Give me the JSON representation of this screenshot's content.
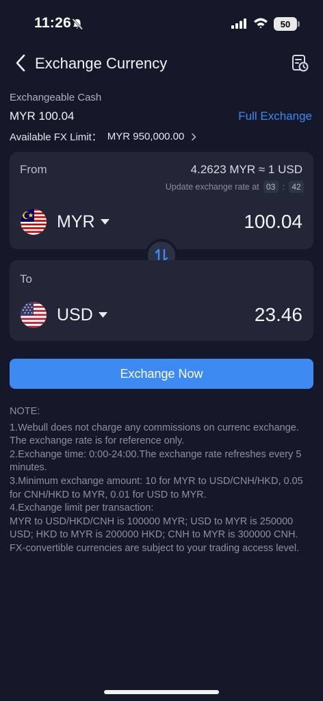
{
  "status_bar": {
    "time": "11:26",
    "battery": "50",
    "icons": [
      "bell-off-icon",
      "signal-icon",
      "wifi-icon",
      "battery-icon"
    ]
  },
  "nav": {
    "title": "Exchange Currency",
    "back_icon": "chevron-left-icon",
    "history_icon": "history-icon"
  },
  "cash": {
    "label": "Exchangeable Cash",
    "value": "MYR 100.04",
    "full_exchange": "Full Exchange",
    "fx_limit_label": "Available FX Limit：",
    "fx_limit_value": "MYR 950,000.00"
  },
  "from": {
    "label": "From",
    "rate": "4.2623 MYR ≈ 1 USD",
    "update_label": "Update exchange rate at",
    "update_min": "03",
    "update_sec": "42",
    "currency": "MYR",
    "amount": "100.04"
  },
  "to": {
    "label": "To",
    "currency": "USD",
    "amount": "23.46"
  },
  "exchange_button": "Exchange Now",
  "note": {
    "title": "NOTE:",
    "lines": [
      "1.Webull does not charge any commissions on currenc exchange. The exchange rate is for reference only.",
      "2.Exchange time: 0:00-24:00.The exchange rate refreshes every 5 minutes.",
      "3.Minimum exchange amount: 10 for MYR to USD/CNH/HKD, 0.05 for CNH/HKD to MYR, 0.01 for USD to MYR.",
      "4.Exchange limit per transaction:",
      "MYR to USD/HKD/CNH is 100000 MYR; USD to MYR is 250000 USD; HKD to MYR is 200000 HKD; CNH to MYR is 300000 CNH. FX-convertible currencies are subject to your trading access level."
    ]
  },
  "colors": {
    "background": "#141828",
    "card": "#222637",
    "accent": "#3d8bf2"
  }
}
